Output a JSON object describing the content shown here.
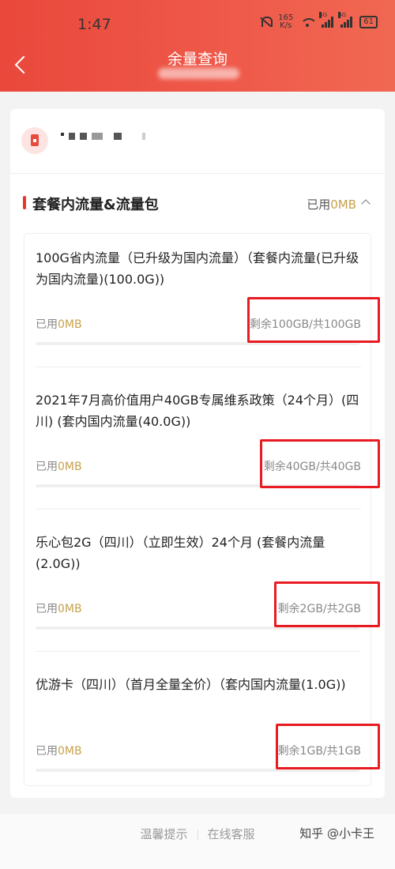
{
  "status_bar": {
    "time": "1:47",
    "speed_value": "165",
    "speed_unit": "K/s",
    "net1": "5G",
    "net2": "4G",
    "battery": "61"
  },
  "header": {
    "title": "余量查询"
  },
  "section": {
    "title": "套餐内流量&流量包",
    "used_prefix": "已用",
    "used_value": "0MB"
  },
  "packages": [
    {
      "name": "100G省内流量（已升级为国内流量）（套餐内流量(已升级为国内流量)(100.0G))",
      "used_prefix": "已用",
      "used_value": "0MB",
      "remaining": "剩余100GB/共100GB",
      "used_fraction": 0
    },
    {
      "name": "2021年7月高价值用户40GB专属维系政策（24个月）(四川) (套内国内流量(40.0G))",
      "used_prefix": "已用",
      "used_value": "0MB",
      "remaining": "剩余40GB/共40GB",
      "used_fraction": 0
    },
    {
      "name": "乐心包2G（四川）（立即生效）24个月 (套餐内流量(2.0G))",
      "used_prefix": "已用",
      "used_value": "0MB",
      "remaining": "剩余2GB/共2GB",
      "used_fraction": 0
    },
    {
      "name": "优游卡（四川）（首月全量全价）（套内国内流量(1.0G))",
      "used_prefix": "已用",
      "used_value": "0MB",
      "remaining": "剩余1GB/共1GB",
      "used_fraction": 0
    }
  ],
  "footer": {
    "tips": "温馨提示",
    "service": "在线客服",
    "watermark": "知乎 @小卡王"
  },
  "colors": {
    "header_red": "#e9483b",
    "gold": "#c8a14a",
    "highlight": "#e81b22"
  }
}
